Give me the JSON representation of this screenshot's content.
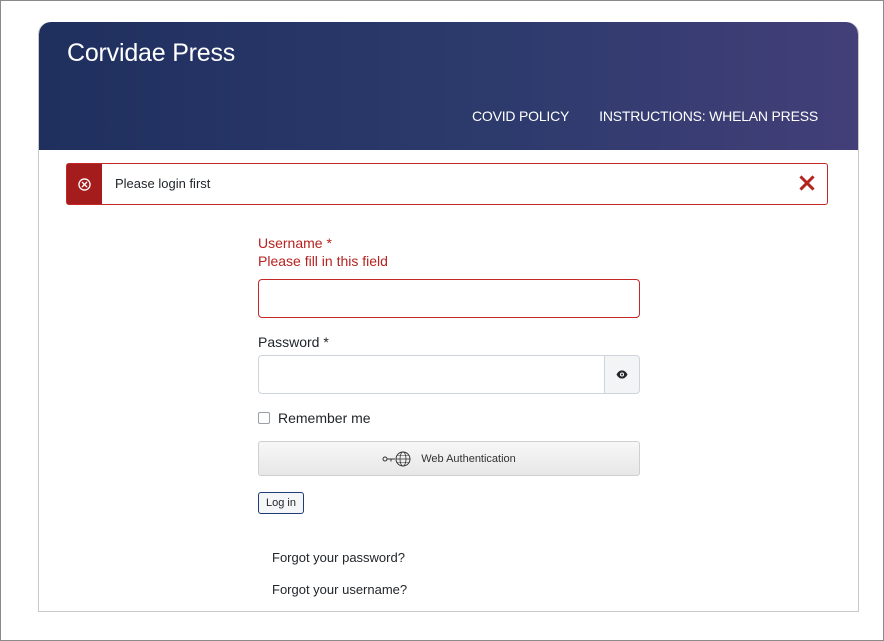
{
  "site": {
    "brand": "Corvidae Press"
  },
  "nav": {
    "items": [
      {
        "label": "COVID POLICY"
      },
      {
        "label": "INSTRUCTIONS: WHELAN PRESS"
      }
    ]
  },
  "alert": {
    "message": "Please login first",
    "color": "#a41c1c"
  },
  "login_form": {
    "username_label": "Username *",
    "username_error": "Please fill in this field",
    "username_value": "",
    "password_label": "Password *",
    "password_value": "",
    "remember_label": "Remember me",
    "remember_checked": false,
    "webauthn_label": "Web Authentication",
    "login_label": "Log in"
  },
  "links": {
    "forgot_password": "Forgot your password?",
    "forgot_username": "Forgot your username?"
  },
  "icons": {
    "alert": "error-circle-icon",
    "close": "close-x-icon",
    "password_toggle": "eye-icon",
    "webauthn": "key-globe-icon"
  },
  "colors": {
    "header_start": "#1f2f5e",
    "header_end": "#433f78",
    "error": "#b5231f"
  }
}
